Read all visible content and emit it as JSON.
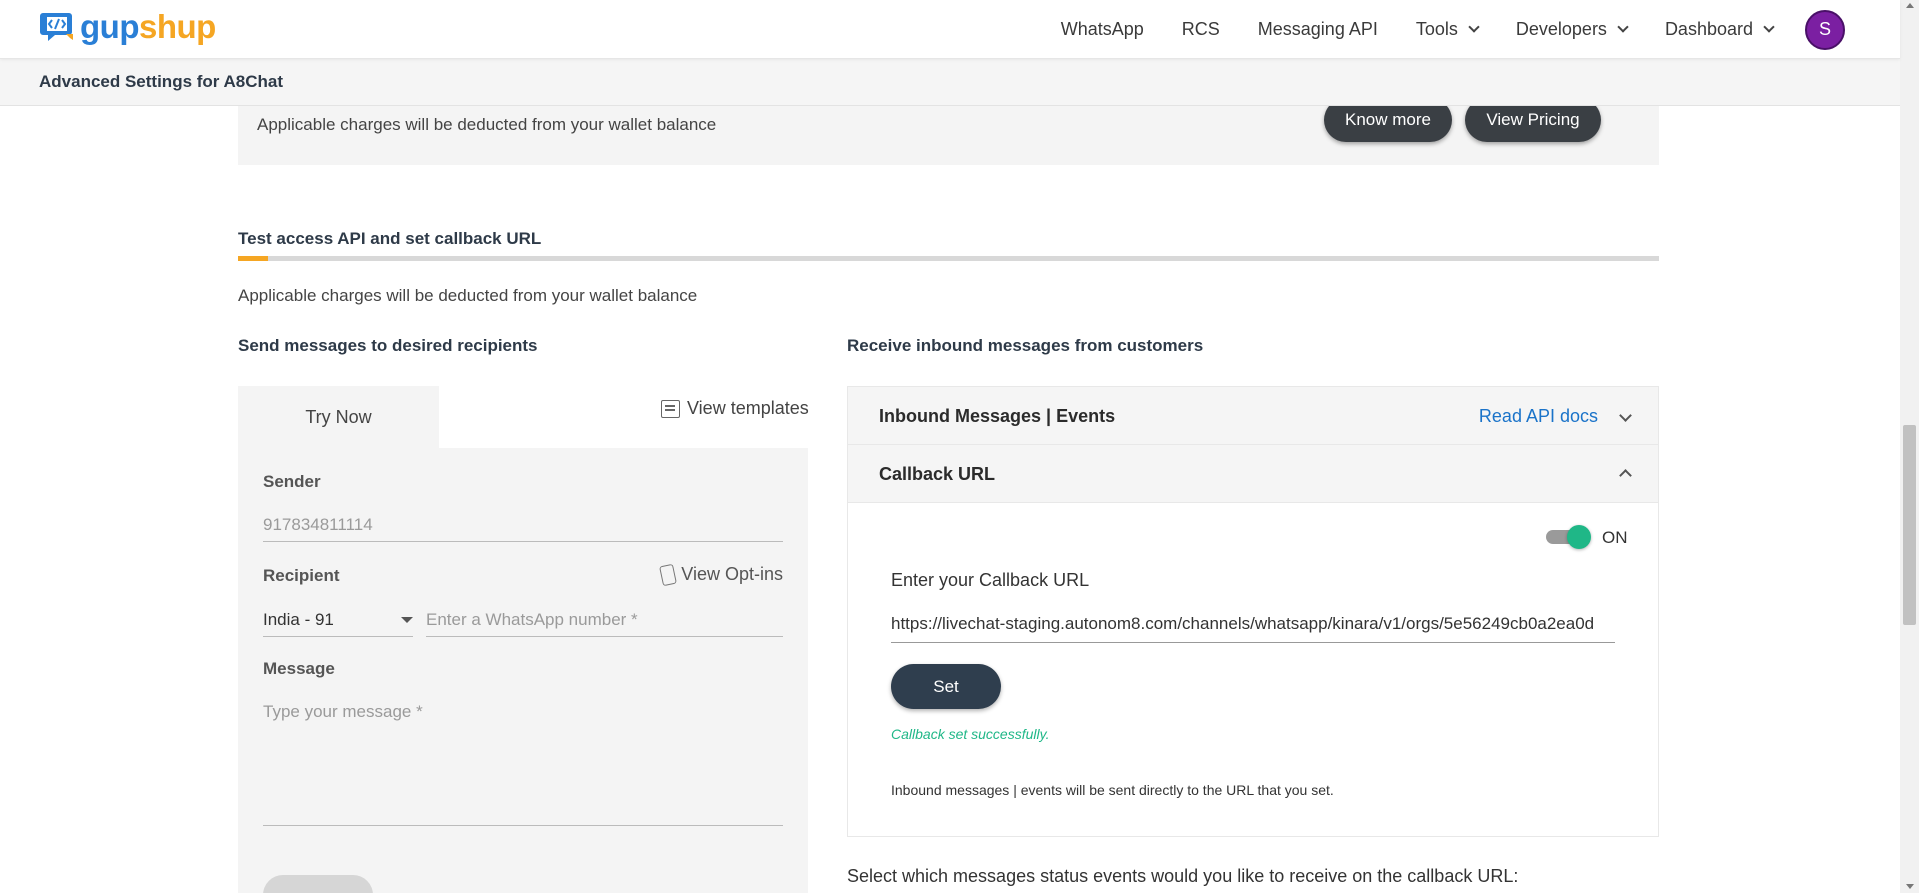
{
  "nav": {
    "logo_text_part1": "gup",
    "logo_text_part2": "shup",
    "links": {
      "whatsapp": "WhatsApp",
      "rcs": "RCS",
      "messaging_api": "Messaging API",
      "tools": "Tools",
      "developers": "Developers",
      "dashboard": "Dashboard"
    },
    "avatar_initial": "S"
  },
  "settings_bar": {
    "title": "Advanced Settings for A8Chat"
  },
  "banner": {
    "text": "Applicable charges will be deducted from your wallet balance",
    "know_more": "Know more",
    "view_pricing": "View Pricing"
  },
  "section": {
    "title": "Test access API and set callback URL",
    "note": "Applicable charges will be deducted from your wallet balance"
  },
  "send": {
    "title": "Send messages to desired recipients",
    "tab_try_now": "Try Now",
    "view_templates": "View templates",
    "sender_label": "Sender",
    "sender_value": "917834811114",
    "recipient_label": "Recipient",
    "view_optins": "View Opt-ins",
    "country_code": "India - 91",
    "number_placeholder": "Enter a WhatsApp number *",
    "message_label": "Message",
    "message_placeholder": "Type your message *"
  },
  "receive": {
    "title": "Receive inbound messages from customers",
    "inbound_header": "Inbound Messages | Events",
    "read_api_docs": "Read API docs",
    "callback_header": "Callback URL",
    "toggle_state": "ON",
    "callback_label": "Enter your Callback URL",
    "callback_value": "https://livechat-staging.autonom8.com/channels/whatsapp/kinara/v1/orgs/5e56249cb0a2ea0d",
    "set_button": "Set",
    "success_msg": "Callback set successfully.",
    "info_msg": "Inbound messages | events will be sent directly to the URL that you set.",
    "status_events_question": "Select which messages status events would you like to receive on the callback URL:"
  },
  "colors": {
    "brand_blue": "#2a7fd6",
    "brand_orange": "#f5a623",
    "dark_button": "#2f3e4e",
    "success_green": "#1fb787",
    "link_blue": "#1a73c9",
    "avatar_purple": "#7b1fa2"
  }
}
